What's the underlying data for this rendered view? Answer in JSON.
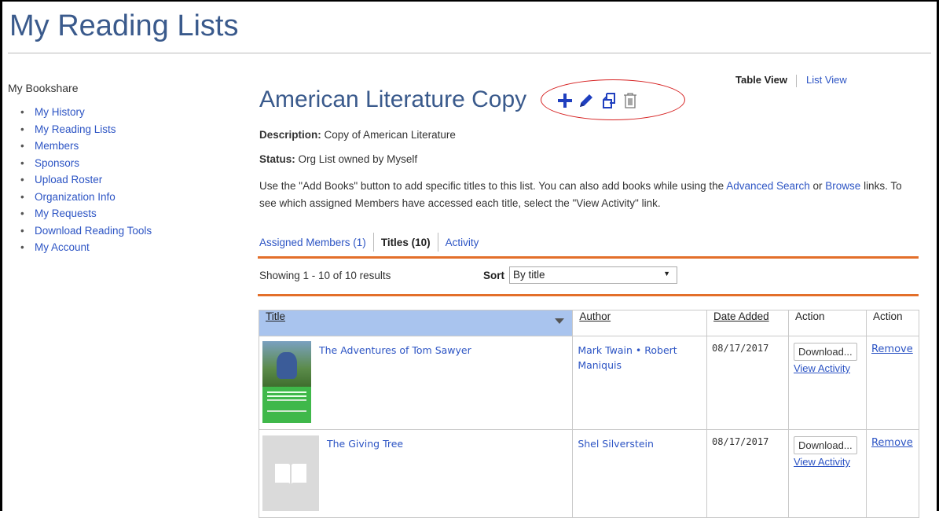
{
  "page": {
    "title": "My Reading Lists"
  },
  "sidebar": {
    "heading": "My Bookshare",
    "items": [
      {
        "label": "My History"
      },
      {
        "label": "My Reading Lists"
      },
      {
        "label": "Members"
      },
      {
        "label": "Sponsors"
      },
      {
        "label": "Upload Roster"
      },
      {
        "label": "Organization Info"
      },
      {
        "label": "My Requests"
      },
      {
        "label": "Download Reading Tools"
      },
      {
        "label": "My Account"
      }
    ]
  },
  "view_toggle": {
    "active": "Table View",
    "other": "List View"
  },
  "list": {
    "title": "American Literature Copy",
    "description_label": "Description:",
    "description": "Copy of American Literature",
    "status_label": "Status:",
    "status": "Org List owned by Myself",
    "instructions_before": "Use the \"Add Books\" button to add specific titles to this list. You can also add books while using the ",
    "advanced_search": "Advanced Search",
    "or_text": " or ",
    "browse": "Browse",
    "instructions_after": " links. To see which assigned Members have accessed each title, select the \"View Activity\" link."
  },
  "title_icons": [
    "plus-icon",
    "pencil-icon",
    "copy-icon",
    "trash-icon"
  ],
  "tabs": [
    {
      "label": "Assigned Members (1)",
      "active": false
    },
    {
      "label": "Titles (10)",
      "active": true
    },
    {
      "label": "Activity",
      "active": false
    }
  ],
  "results": {
    "showing": "Showing 1 - 10 of 10 results",
    "sort_label": "Sort",
    "sort_value": "By title"
  },
  "table": {
    "headers": {
      "title": "Title",
      "author": "Author",
      "date_added": "Date Added",
      "action1": "Action",
      "action2": "Action"
    },
    "rows": [
      {
        "title": "The Adventures of Tom Sawyer",
        "author": "Mark Twain • Robert Maniquis",
        "date": "08/17/2017",
        "download": "Download...",
        "view_activity": "View Activity",
        "remove": "Remove"
      },
      {
        "title": "The Giving Tree",
        "author": "Shel Silverstein",
        "date": "08/17/2017",
        "download": "Download...",
        "view_activity": "View Activity",
        "remove": "Remove"
      }
    ]
  },
  "colors": {
    "accent": "#e36f2a",
    "link": "#2c54c4",
    "title": "#3a5a8c",
    "header_highlight": "#a9c4ee",
    "annotation": "#d62020"
  }
}
